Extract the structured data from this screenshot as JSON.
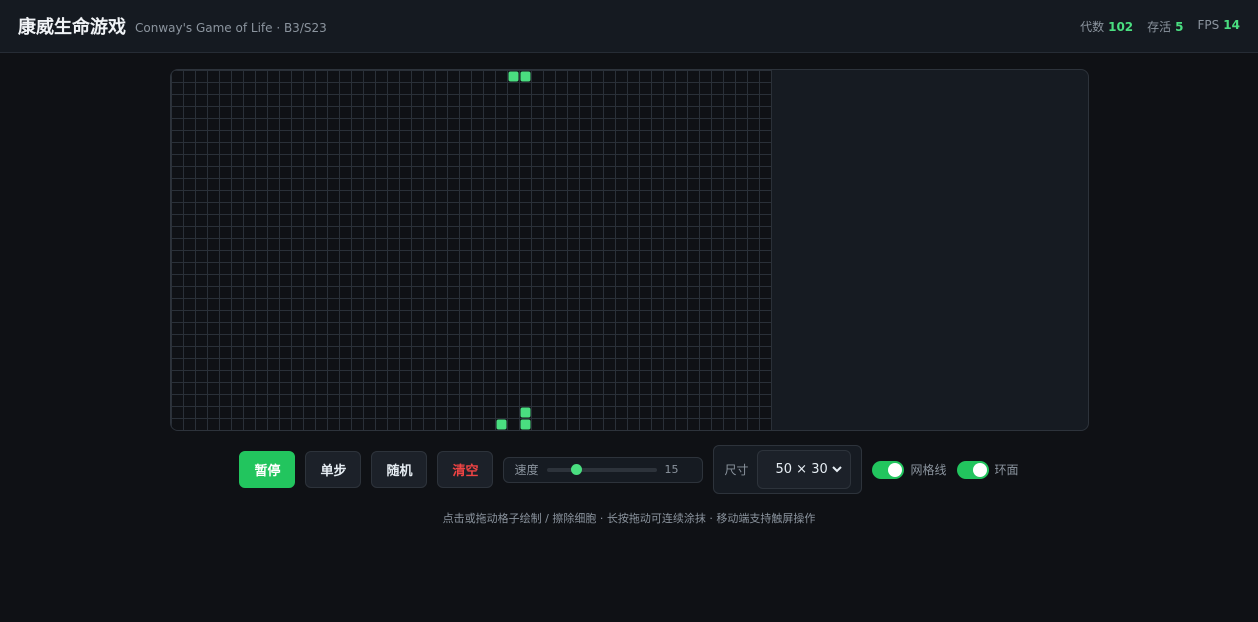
{
  "header": {
    "title": "康威生命游戏",
    "subtitle": "Conway's Game of Life · B3/S23",
    "stats": [
      {
        "label": "代数",
        "value": "102"
      },
      {
        "label": "存活",
        "value": "5"
      },
      {
        "label": "FPS",
        "value": "14"
      }
    ]
  },
  "board": {
    "cols": 50,
    "rows": 30,
    "live_cells": [
      [
        28,
        0
      ],
      [
        29,
        0
      ],
      [
        29,
        28
      ],
      [
        27,
        29
      ],
      [
        29,
        29
      ]
    ],
    "grid_color": "#2a3038",
    "cell_color": "#4ade80"
  },
  "controls": {
    "pause_label": "暂停",
    "step_label": "单步",
    "random_label": "随机",
    "clear_label": "清空",
    "speed_label": "速度",
    "speed_value": "15",
    "size_label": "尺寸",
    "size_value": "50 × 30",
    "grid_toggle_label": "网格线",
    "grid_toggle_on": true,
    "torus_toggle_label": "环面",
    "torus_toggle_on": true
  },
  "hint": "点击或拖动格子绘制 / 擦除细胞 · 长按拖动可连续涂抹 · 移动端支持触屏操作",
  "colors": {
    "accent": "#22c55e",
    "danger": "#ef4444",
    "background": "#0f1115"
  }
}
